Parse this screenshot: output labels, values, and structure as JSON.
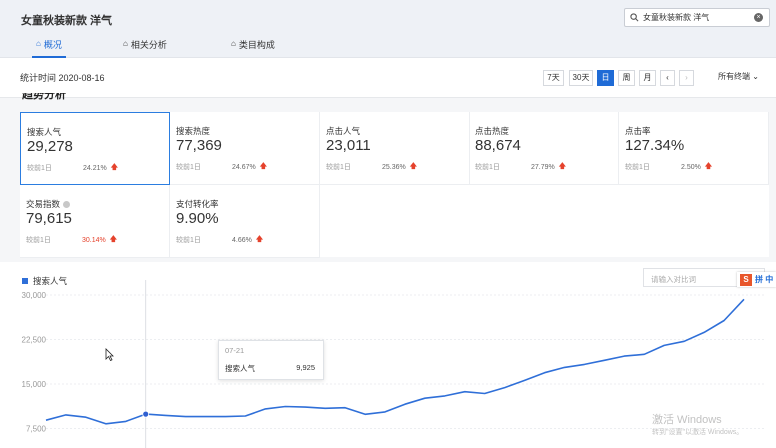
{
  "header": {
    "title": "女童秋装新款 洋气",
    "search_value": "女童秋装新款 洋气",
    "tabs": [
      {
        "label": "概况",
        "icon": "home-icon"
      },
      {
        "label": "相关分析",
        "icon": "bag-icon"
      },
      {
        "label": "类目构成",
        "icon": "bag-icon"
      }
    ]
  },
  "toolbar": {
    "stat_time": "统计时间 2020-08-16",
    "ranges": [
      "7天",
      "30天",
      "日",
      "周",
      "月"
    ],
    "active_range": "日",
    "terminals": "所有终端"
  },
  "section": {
    "title": "趋势分析"
  },
  "metrics": [
    {
      "label": "搜索人气",
      "value": "29,278",
      "compare": "较前1日",
      "change": "24.21%"
    },
    {
      "label": "搜索热度",
      "value": "77,369",
      "compare": "较前1日",
      "change": "24.67%"
    },
    {
      "label": "点击人气",
      "value": "23,011",
      "compare": "较前1日",
      "change": "25.36%"
    },
    {
      "label": "点击热度",
      "value": "88,674",
      "compare": "较前1日",
      "change": "27.79%"
    },
    {
      "label": "点击率",
      "value": "127.34%",
      "compare": "较前1日",
      "change": "2.50%"
    },
    {
      "label": "交易指数",
      "value": "79,615",
      "compare": "较前1日",
      "change": "30.14%"
    },
    {
      "label": "支付转化率",
      "value": "9.90%",
      "compare": "较前1日",
      "change": "4.66%"
    }
  ],
  "chart_panel": {
    "legend": "搜索人气",
    "compare_placeholder": "请输入对比词"
  },
  "tooltip": {
    "date": "07-21",
    "label": "搜索人气",
    "value": "9,925"
  },
  "ime": {
    "text": "拼 中"
  },
  "watermark": {
    "title": "激活 Windows",
    "subtitle": "转到\"设置\"以激活 Windows。"
  },
  "colors": {
    "accent": "#1f6bd6",
    "line": "#2f6fd8",
    "up": "#e5422c"
  },
  "chart_data": {
    "type": "line",
    "ylim": [
      0,
      30000
    ],
    "yticks": [
      "30,000",
      "22,500",
      "15,000",
      "7,500"
    ],
    "ytick_values": [
      30000,
      22500,
      15000,
      7500
    ],
    "series": [
      {
        "name": "搜索人气",
        "values": [
          8900,
          9800,
          9400,
          8300,
          8700,
          9925,
          9700,
          9500,
          9500,
          9500,
          9600,
          10800,
          11200,
          11100,
          10900,
          11000,
          9900,
          10300,
          11600,
          12600,
          13000,
          13700,
          13400,
          14400,
          15600,
          16900,
          17800,
          18300,
          19000,
          19700,
          20000,
          21500,
          22200,
          23700,
          25700,
          29278
        ]
      }
    ],
    "highlight_index": 5
  }
}
